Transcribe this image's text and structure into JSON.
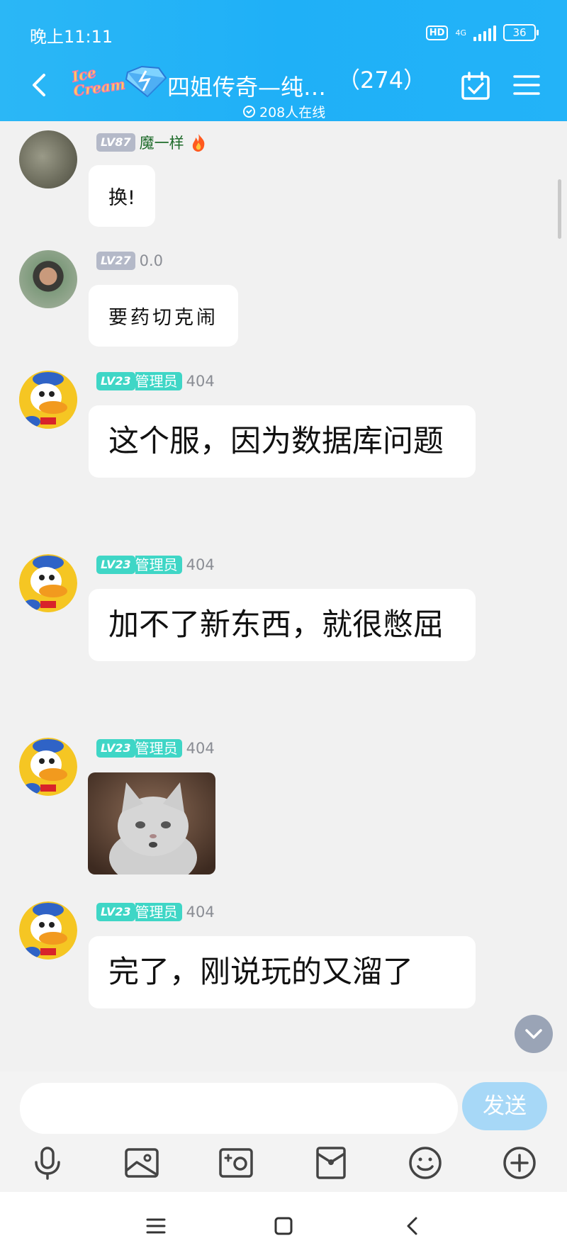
{
  "status": {
    "time": "晚上11:11",
    "hd": "HD",
    "network": "4G",
    "battery": "36"
  },
  "header": {
    "logo_text": "Ice Cream",
    "title": "四姐传奇—纯…",
    "count": "（274）",
    "online": "208人在线"
  },
  "messages": [
    {
      "level": "LV87",
      "role": "",
      "name": "魔一样",
      "text": "换!"
    },
    {
      "level": "LV27",
      "role": "",
      "name": "0.0",
      "text": "要药切克闹"
    },
    {
      "level": "LV23",
      "role": "管理员",
      "name": "404",
      "text": "这个服，因为数据库问题"
    },
    {
      "level": "LV23",
      "role": "管理员",
      "name": "404",
      "text": "加不了新东西，就很憋屈"
    },
    {
      "level": "LV23",
      "role": "管理员",
      "name": "404",
      "text": ""
    },
    {
      "level": "LV23",
      "role": "管理员",
      "name": "404",
      "text": "完了，刚说玩的又溜了"
    }
  ],
  "input": {
    "placeholder": "",
    "send_label": "发送"
  },
  "toolbar": [
    "microphone-icon",
    "image-icon",
    "camera-icon",
    "red-packet-icon",
    "emoji-icon",
    "plus-icon"
  ],
  "navbar": [
    "menu-icon",
    "home-icon",
    "back-icon"
  ],
  "colors": {
    "header": "#1fb0f7",
    "admin_badge": "#3fd6c6",
    "level_badge": "#b4b9c8",
    "send_button": "#a7d8f7"
  }
}
